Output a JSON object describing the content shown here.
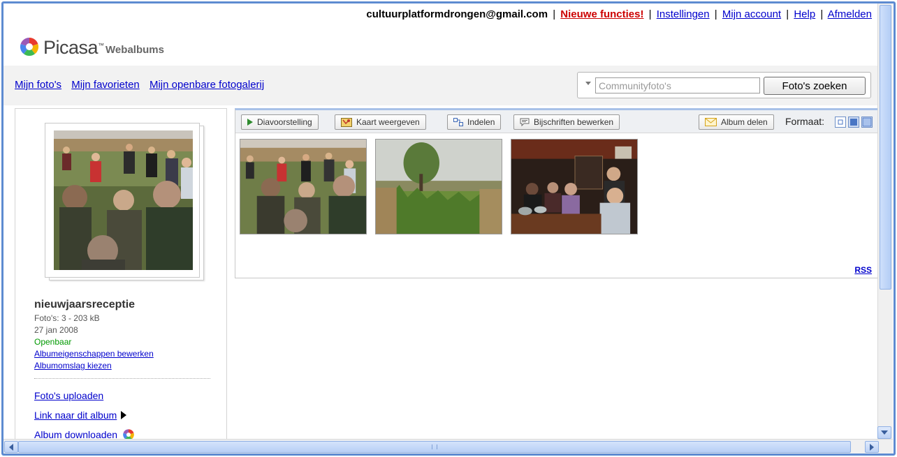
{
  "topnav": {
    "user_email": "cultuurplatformdrongen@gmail.com",
    "links": [
      "Nieuwe functies!",
      "Instellingen",
      "Mijn account",
      "Help",
      "Afmelden"
    ],
    "separator": "|"
  },
  "logo": {
    "word": "Picasa",
    "tm": "™",
    "sub": "Webalbums"
  },
  "nav": {
    "links": [
      "Mijn foto's",
      "Mijn favorieten",
      "Mijn openbare fotogalerij"
    ]
  },
  "search": {
    "placeholder": "Communityfoto's",
    "button": "Foto's zoeken"
  },
  "album": {
    "title": "nieuwjaarsreceptie",
    "photos_line": "Foto's: 3 - 203 kB",
    "date": "27 jan 2008",
    "visibility": "Openbaar",
    "edit_link": "Albumeigenschappen bewerken",
    "cover_link": "Albumomslag kiezen"
  },
  "sidebar_actions": {
    "upload": "Foto's uploaden",
    "link": "Link naar dit album",
    "download": "Album downloaden"
  },
  "toolbar": {
    "slideshow": "Diavoorstelling",
    "map": "Kaart weergeven",
    "organize": "Indelen",
    "captions": "Bijschriften bewerken",
    "share": "Album delen",
    "format_label": "Formaat:"
  },
  "rss": "RSS",
  "colors": {
    "link": "#0000cc",
    "new_features": "#cc0000",
    "public_green": "#009900",
    "frame_blue": "#5d8bd1"
  }
}
